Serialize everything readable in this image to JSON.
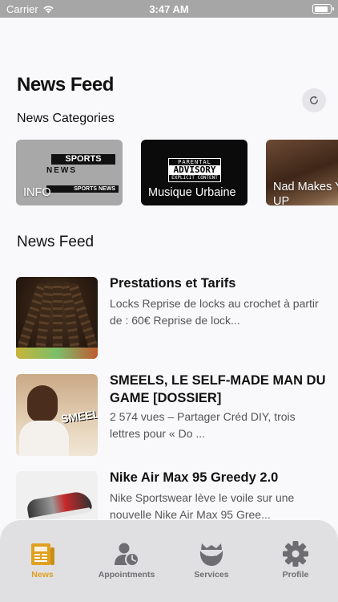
{
  "status_bar": {
    "carrier": "Carrier",
    "time": "3:47 AM",
    "battery_level": 0.9
  },
  "header": {
    "title": "News Feed",
    "refresh_icon": "refresh-icon"
  },
  "categories": {
    "title": "News Categories",
    "items": [
      {
        "label": "INFO",
        "image_text": [
          "SPORTS",
          "NEWS",
          "SPORTS NEWS"
        ]
      },
      {
        "label": "Musique Urbaine",
        "image_text": [
          "PARENTAL",
          "ADVISORY",
          "EXPLICIT CONTENT"
        ]
      },
      {
        "label": "Nad Makes Y",
        "label_line2": "UP"
      }
    ]
  },
  "feed": {
    "title": "News Feed",
    "items": [
      {
        "title": "Prestations et Tarifs",
        "description": "Locks Reprise de locks au crochet à partir de : 60€ Reprise de lock..."
      },
      {
        "title": "SMEELS, LE SELF-MADE MAN DU GAME [DOSSIER]",
        "description": "2 574 vues – Partager Créd DIY, trois lettres pour « Do ...",
        "thumb_text": "SMEELS"
      },
      {
        "title": "Nike Air Max 95 Greedy 2.0",
        "description": "Nike Sportswear lève le voile sur une nouvelle Nike Air Max 95 Gree..."
      }
    ]
  },
  "tab_bar": {
    "accent_color": "#e0a020",
    "inactive_color": "#6e6e72",
    "tabs": [
      {
        "label": "News",
        "icon": "newspaper-icon",
        "active": true
      },
      {
        "label": "Appointments",
        "icon": "person-clock-icon",
        "active": false
      },
      {
        "label": "Services",
        "icon": "beard-icon",
        "active": false
      },
      {
        "label": "Profile",
        "icon": "gear-icon",
        "active": false
      }
    ]
  }
}
